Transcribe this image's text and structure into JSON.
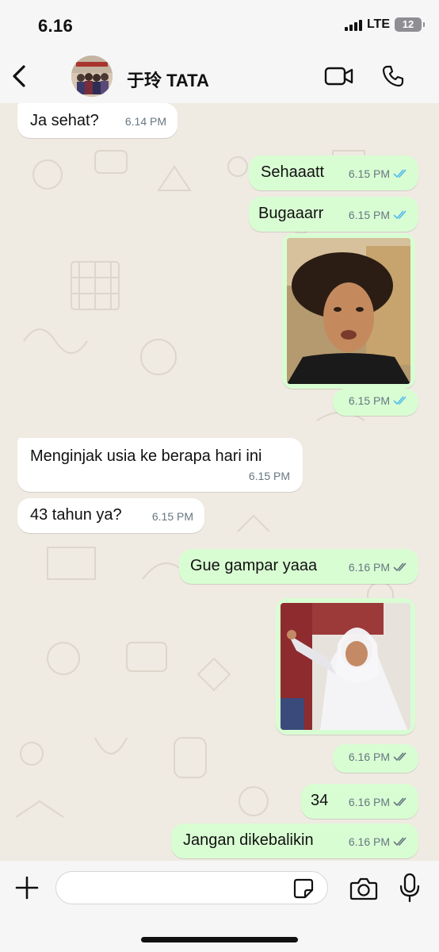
{
  "status_bar": {
    "time": "6.16",
    "network": "LTE",
    "battery": "12"
  },
  "header": {
    "contact_name": "于玲 TATA",
    "icons": {
      "back": "chevron-left-icon",
      "video": "video-camera-icon",
      "call": "phone-icon"
    }
  },
  "messages": [
    {
      "direction": "in",
      "type": "text",
      "text": "Ja sehat?",
      "time": "6.14 PM"
    },
    {
      "direction": "out",
      "type": "text",
      "text": "Sehaaatt",
      "time": "6.15 PM",
      "status": "read"
    },
    {
      "direction": "out",
      "type": "text",
      "text": "Bugaaarr",
      "time": "6.15 PM",
      "status": "read"
    },
    {
      "direction": "out",
      "type": "image",
      "time": "6.15 PM",
      "status": "read"
    },
    {
      "direction": "in",
      "type": "text",
      "text": "Menginjak usia ke berapa hari ini",
      "time": "6.15 PM"
    },
    {
      "direction": "in",
      "type": "text",
      "text": "43 tahun ya?",
      "time": "6.15 PM"
    },
    {
      "direction": "out",
      "type": "text",
      "text": "Gue gampar yaaa",
      "time": "6.16 PM",
      "status": "delivered"
    },
    {
      "direction": "out",
      "type": "image",
      "time": "6.16 PM",
      "status": "delivered"
    },
    {
      "direction": "out",
      "type": "text",
      "text": "34",
      "time": "6.16 PM",
      "status": "delivered"
    },
    {
      "direction": "out",
      "type": "text",
      "text": "Jangan dikebalikin",
      "time": "6.16 PM",
      "status": "delivered"
    }
  ],
  "input_bar": {
    "placeholder": "",
    "icons": {
      "attach": "plus-icon",
      "sticker": "sticker-icon",
      "camera": "camera-icon",
      "mic": "microphone-icon"
    }
  },
  "colors": {
    "incoming_bubble": "#ffffff",
    "outgoing_bubble": "#d9fdd3",
    "wallpaper": "#efeae2",
    "read_ticks": "#53bdeb",
    "delivered_ticks": "#667781"
  }
}
